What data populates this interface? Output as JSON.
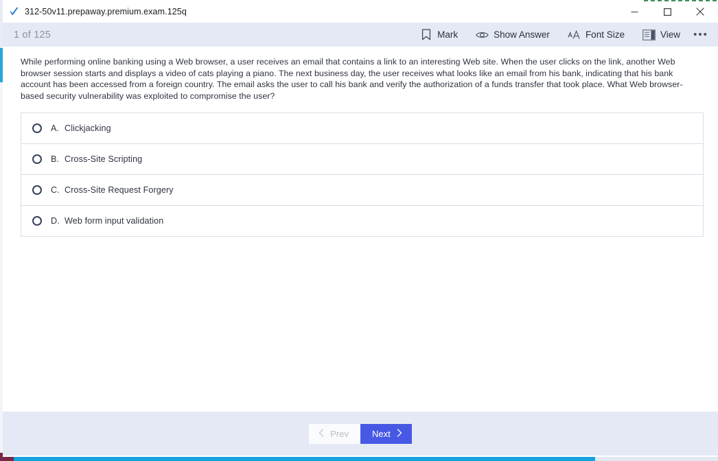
{
  "window": {
    "title": "312-50v11.prepaway.premium.exam.125q",
    "title_icon": "blue-checkmark-icon",
    "controls": {
      "minimize": "minimize-icon",
      "maximize": "maximize-icon",
      "close": "close-icon"
    }
  },
  "toolbar": {
    "page_counter": "1 of 125",
    "actions": [
      {
        "label": "Mark",
        "icon": "bookmark-icon"
      },
      {
        "label": "Show Answer",
        "icon": "eye-icon"
      },
      {
        "label": "Font Size",
        "icon": "font-size-icon"
      },
      {
        "label": "View",
        "icon": "view-panel-icon"
      }
    ],
    "more_label": "•••"
  },
  "question": {
    "text": "While performing online banking using a Web browser, a user receives an email that contains a link to an interesting Web site. When the user clicks on the link, another Web browser session starts and displays a video of cats playing a piano. The next business day, the user receives what looks like an email from his bank, indicating that his bank account has been accessed from a foreign country. The email asks the user to call his bank and verify the authorization of a funds transfer that took place. What Web browser-based security vulnerability was exploited to compromise the user?",
    "options": [
      {
        "letter": "A.",
        "label": "Clickjacking",
        "selected": false
      },
      {
        "letter": "B.",
        "label": "Cross-Site Scripting",
        "selected": false
      },
      {
        "letter": "C.",
        "label": "Cross-Site Request Forgery",
        "selected": false
      },
      {
        "letter": "D.",
        "label": "Web form input validation",
        "selected": false
      }
    ]
  },
  "footer": {
    "prev_label": "Prev",
    "next_label": "Next",
    "prev_disabled": true
  },
  "colors": {
    "toolbar_bg": "#e4e9f5",
    "next_button": "#4759e4",
    "option_border": "#d8dde8",
    "text": "#2e3340",
    "counter_text": "#8d93a5"
  }
}
